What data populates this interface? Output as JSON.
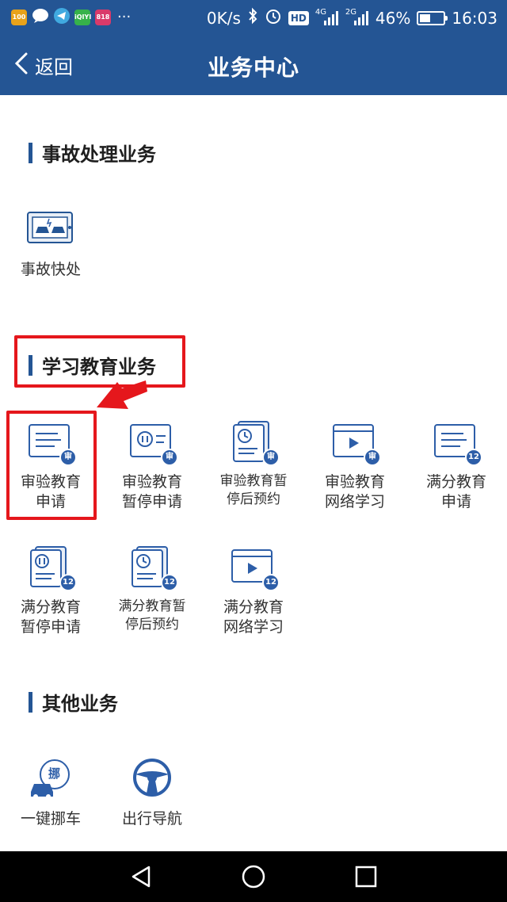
{
  "status_bar": {
    "app_badge_1": "100",
    "app_badge_2": "iQIYI",
    "app_badge_3": "818",
    "more": "···",
    "net_speed": "0K/s",
    "hd": "HD",
    "signal_1_tag": "4G",
    "signal_2_tag": "2G",
    "battery_percent": "46%",
    "battery_level": 0.46,
    "time": "16:03"
  },
  "nav": {
    "back_label": "返回",
    "title": "业务中心"
  },
  "sections": {
    "accident": {
      "title": "事故处理业务",
      "items": [
        {
          "label": "事故快处",
          "icon": "accident-icon"
        }
      ]
    },
    "education": {
      "title": "学习教育业务",
      "items": [
        {
          "label": "审验教育\n申请",
          "icon": "doc-icon",
          "badge": "审"
        },
        {
          "label": "审验教育\n暂停申请",
          "icon": "pause-icon",
          "badge": "审"
        },
        {
          "label": "审验教育暂\n停后预约",
          "icon": "clock-icon",
          "badge": "审"
        },
        {
          "label": "审验教育\n网络学习",
          "icon": "video-icon",
          "badge": "审"
        },
        {
          "label": "满分教育\n申请",
          "icon": "doc-icon",
          "badge": "12"
        },
        {
          "label": "满分教育\n暂停申请",
          "icon": "pause-icon",
          "badge": "12"
        },
        {
          "label": "满分教育暂\n停后预约",
          "icon": "clock-icon",
          "badge": "12"
        },
        {
          "label": "满分教育\n网络学习",
          "icon": "video-icon",
          "badge": "12"
        }
      ]
    },
    "other": {
      "title": "其他业务",
      "items": [
        {
          "label": "一键挪车",
          "icon": "move-car-icon",
          "badge": "挪"
        },
        {
          "label": "出行导航",
          "icon": "steering-wheel-icon"
        }
      ]
    }
  },
  "colors": {
    "brand": "#245594",
    "badge": "#2d5ea8",
    "annotation": "#e5171c"
  }
}
